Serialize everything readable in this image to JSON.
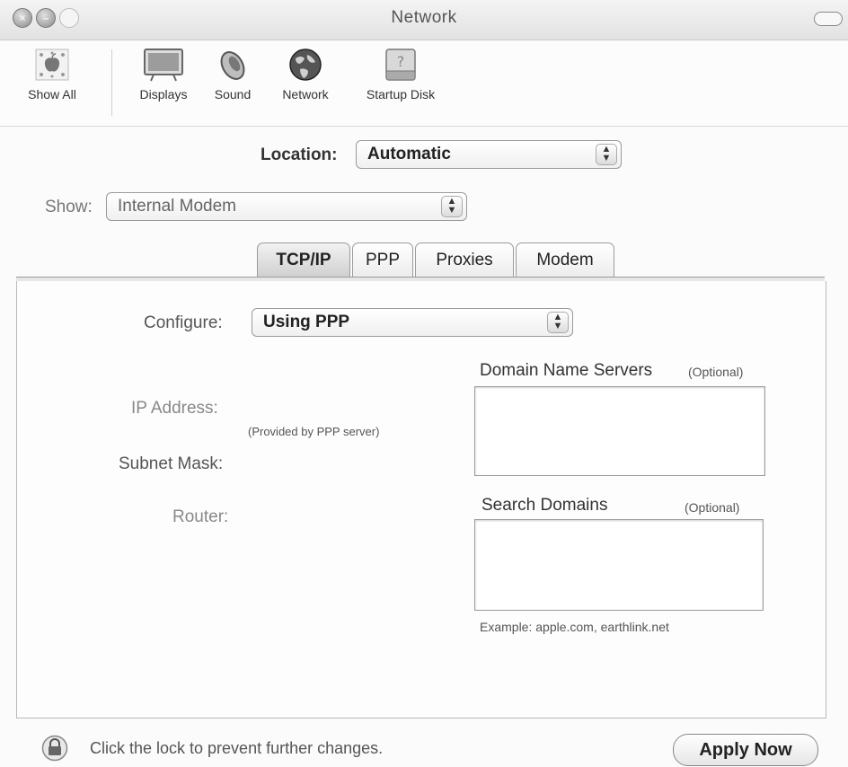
{
  "window": {
    "title": "Network"
  },
  "toolbar": {
    "items": [
      {
        "label": "Show All",
        "icon": "apple-grid-icon"
      },
      {
        "label": "Displays",
        "icon": "display-icon"
      },
      {
        "label": "Sound",
        "icon": "speaker-icon"
      },
      {
        "label": "Network",
        "icon": "globe-icon"
      },
      {
        "label": "Startup Disk",
        "icon": "disk-icon"
      }
    ]
  },
  "location": {
    "label": "Location:",
    "value": "Automatic"
  },
  "show": {
    "label": "Show:",
    "value": "Internal Modem"
  },
  "tabs": [
    {
      "label": "TCP/IP",
      "active": true
    },
    {
      "label": "PPP",
      "active": false
    },
    {
      "label": "Proxies",
      "active": false
    },
    {
      "label": "Modem",
      "active": false
    }
  ],
  "tcpip": {
    "configure_label": "Configure:",
    "configure_value": "Using PPP",
    "ip_label": "IP Address:",
    "provided_note": "(Provided by PPP server)",
    "subnet_label": "Subnet Mask:",
    "router_label": "Router:",
    "dns_label": "Domain Name Servers",
    "dns_optional": "(Optional)",
    "dns_value": "",
    "search_label": "Search Domains",
    "search_optional": "(Optional)",
    "search_value": "",
    "example": "Example: apple.com, earthlink.net"
  },
  "footer": {
    "lock_text": "Click the lock to prevent further changes.",
    "apply_label": "Apply Now"
  }
}
